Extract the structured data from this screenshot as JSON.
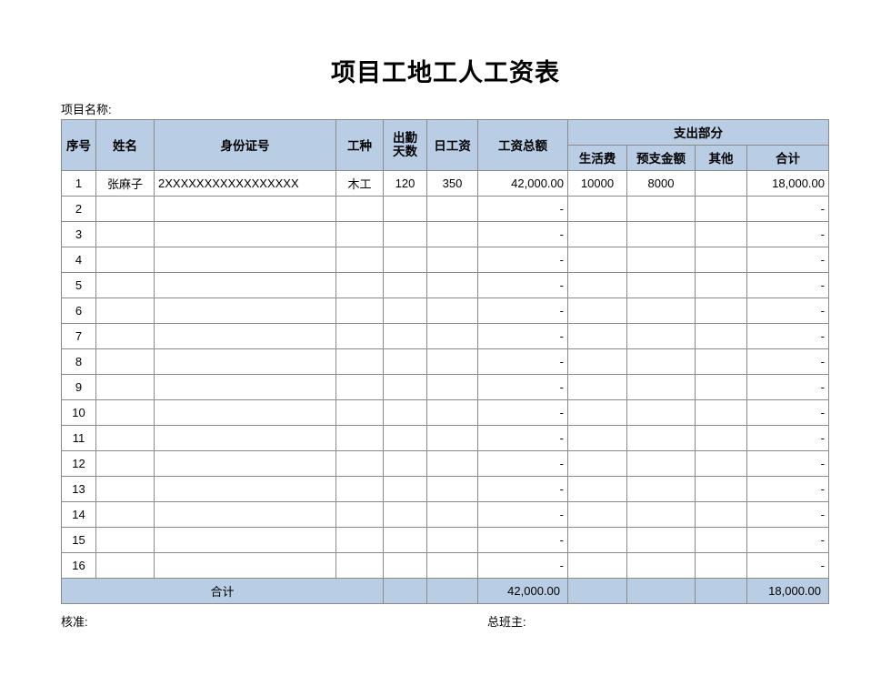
{
  "document": {
    "title": "项目工地工人工资表",
    "project_label": "项目名称:"
  },
  "table": {
    "group_header": "支出部分",
    "columns": {
      "seq": "序号",
      "name": "姓名",
      "id_number": "身份证号",
      "work_type": "工种",
      "attendance_days": "出勤\n天数",
      "attendance_days_line1": "出勤",
      "attendance_days_line2": "天数",
      "daily_wage": "日工资",
      "total_wage": "工资总额",
      "living_cost": "生活费",
      "advance_amount": "预支金额",
      "other": "其他",
      "subtotal": "合计"
    },
    "rows": [
      {
        "seq": "1",
        "name": "张麻子",
        "id_number": "2XXXXXXXXXXXXXXXXX",
        "work_type": "木工",
        "attendance_days": "120",
        "daily_wage": "350",
        "total_wage": "42,000.00",
        "living_cost": "10000",
        "advance_amount": "8000",
        "other": "",
        "subtotal": "18,000.00"
      },
      {
        "seq": "2",
        "name": "",
        "id_number": "",
        "work_type": "",
        "attendance_days": "",
        "daily_wage": "",
        "total_wage": "-",
        "living_cost": "",
        "advance_amount": "",
        "other": "",
        "subtotal": "-"
      },
      {
        "seq": "3",
        "name": "",
        "id_number": "",
        "work_type": "",
        "attendance_days": "",
        "daily_wage": "",
        "total_wage": "-",
        "living_cost": "",
        "advance_amount": "",
        "other": "",
        "subtotal": "-"
      },
      {
        "seq": "4",
        "name": "",
        "id_number": "",
        "work_type": "",
        "attendance_days": "",
        "daily_wage": "",
        "total_wage": "-",
        "living_cost": "",
        "advance_amount": "",
        "other": "",
        "subtotal": "-"
      },
      {
        "seq": "5",
        "name": "",
        "id_number": "",
        "work_type": "",
        "attendance_days": "",
        "daily_wage": "",
        "total_wage": "-",
        "living_cost": "",
        "advance_amount": "",
        "other": "",
        "subtotal": "-"
      },
      {
        "seq": "6",
        "name": "",
        "id_number": "",
        "work_type": "",
        "attendance_days": "",
        "daily_wage": "",
        "total_wage": "-",
        "living_cost": "",
        "advance_amount": "",
        "other": "",
        "subtotal": "-"
      },
      {
        "seq": "7",
        "name": "",
        "id_number": "",
        "work_type": "",
        "attendance_days": "",
        "daily_wage": "",
        "total_wage": "-",
        "living_cost": "",
        "advance_amount": "",
        "other": "",
        "subtotal": "-"
      },
      {
        "seq": "8",
        "name": "",
        "id_number": "",
        "work_type": "",
        "attendance_days": "",
        "daily_wage": "",
        "total_wage": "-",
        "living_cost": "",
        "advance_amount": "",
        "other": "",
        "subtotal": "-"
      },
      {
        "seq": "9",
        "name": "",
        "id_number": "",
        "work_type": "",
        "attendance_days": "",
        "daily_wage": "",
        "total_wage": "-",
        "living_cost": "",
        "advance_amount": "",
        "other": "",
        "subtotal": "-"
      },
      {
        "seq": "10",
        "name": "",
        "id_number": "",
        "work_type": "",
        "attendance_days": "",
        "daily_wage": "",
        "total_wage": "-",
        "living_cost": "",
        "advance_amount": "",
        "other": "",
        "subtotal": "-"
      },
      {
        "seq": "11",
        "name": "",
        "id_number": "",
        "work_type": "",
        "attendance_days": "",
        "daily_wage": "",
        "total_wage": "-",
        "living_cost": "",
        "advance_amount": "",
        "other": "",
        "subtotal": "-"
      },
      {
        "seq": "12",
        "name": "",
        "id_number": "",
        "work_type": "",
        "attendance_days": "",
        "daily_wage": "",
        "total_wage": "-",
        "living_cost": "",
        "advance_amount": "",
        "other": "",
        "subtotal": "-"
      },
      {
        "seq": "13",
        "name": "",
        "id_number": "",
        "work_type": "",
        "attendance_days": "",
        "daily_wage": "",
        "total_wage": "-",
        "living_cost": "",
        "advance_amount": "",
        "other": "",
        "subtotal": "-"
      },
      {
        "seq": "14",
        "name": "",
        "id_number": "",
        "work_type": "",
        "attendance_days": "",
        "daily_wage": "",
        "total_wage": "-",
        "living_cost": "",
        "advance_amount": "",
        "other": "",
        "subtotal": "-"
      },
      {
        "seq": "15",
        "name": "",
        "id_number": "",
        "work_type": "",
        "attendance_days": "",
        "daily_wage": "",
        "total_wage": "-",
        "living_cost": "",
        "advance_amount": "",
        "other": "",
        "subtotal": "-"
      },
      {
        "seq": "16",
        "name": "",
        "id_number": "",
        "work_type": "",
        "attendance_days": "",
        "daily_wage": "",
        "total_wage": "-",
        "living_cost": "",
        "advance_amount": "",
        "other": "",
        "subtotal": "-"
      }
    ],
    "total_row": {
      "label": "合计",
      "total_wage": "42,000.00",
      "living_cost": "",
      "advance_amount": "",
      "other": "",
      "subtotal": "18,000.00"
    }
  },
  "footer": {
    "approver_label": "核准:",
    "foreman_label": "总班主:"
  },
  "colors": {
    "header_fill": "#b9cde5",
    "border": "#8a8a8a",
    "page_background": "#ffffff",
    "text": "#000000"
  }
}
